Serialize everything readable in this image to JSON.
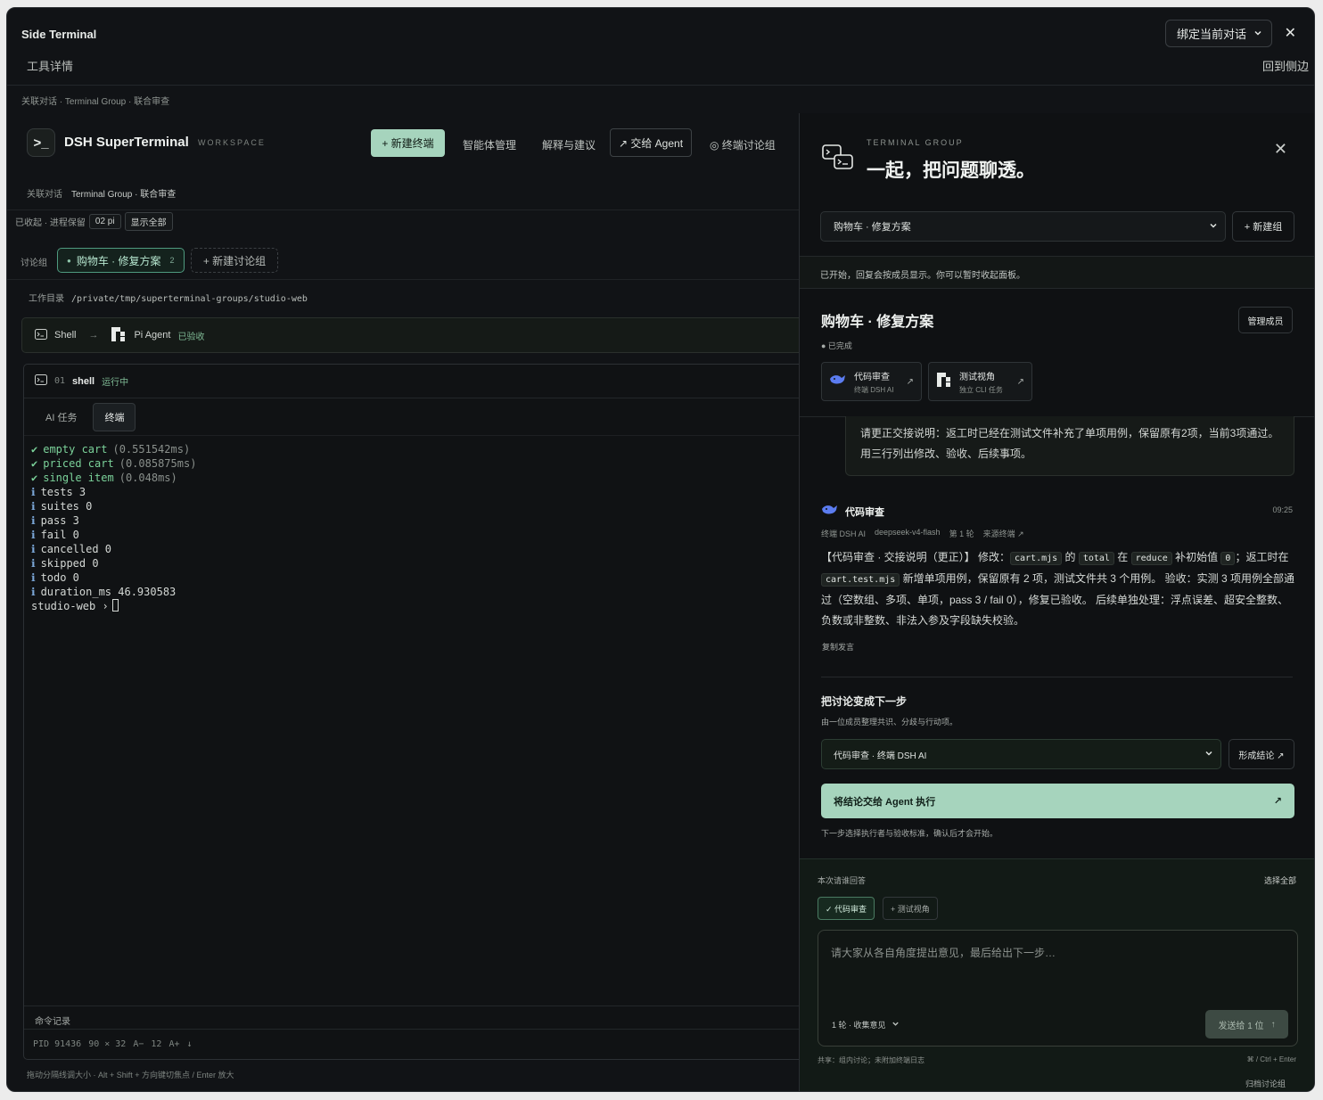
{
  "window": {
    "title": "Side Terminal",
    "subtitle": "工具详情",
    "bind_select": "绑定当前对话",
    "back_to_side": "回到侧边",
    "breadcrumb": "关联对话 · Terminal Group · 联合审查"
  },
  "app": {
    "logo": ">_",
    "name": "DSH SuperTerminal",
    "workspace": "WORKSPACE",
    "new_terminal": "+ 新建终端",
    "nav": [
      "智能体管理",
      "解释与建议"
    ],
    "handoff_agent": "↗ 交给 Agent",
    "terminal_discussion": "◎ 终端讨论组",
    "crumb_label": "关联对话",
    "crumb_value": "Terminal Group · 联合审查",
    "collapsed_label": "已收起 · 进程保留",
    "collapsed_chip": "02 pi",
    "show_all": "显示全部",
    "group_label": "讨论组",
    "group_tab": "购物车 · 修复方案",
    "group_count": "2",
    "new_group": "+ 新建讨论组",
    "workdir_label": "工作目录",
    "workdir_path": "/private/tmp/superterminal-groups/studio-web"
  },
  "flow": {
    "from": "Shell",
    "to": "Pi Agent",
    "status": "已验收"
  },
  "terminal": {
    "index": "01",
    "name": "shell",
    "status": "运行中",
    "tabs": [
      "AI 任务",
      "终端"
    ],
    "lines": [
      {
        "mark": "✔",
        "text": "empty cart",
        "time": "(0.551542ms)"
      },
      {
        "mark": "✔",
        "text": "priced cart",
        "time": "(0.085875ms)"
      },
      {
        "mark": "✔",
        "text": "single item",
        "time": "(0.048ms)"
      },
      {
        "mark": "ℹ",
        "text": "tests 3",
        "time": ""
      },
      {
        "mark": "ℹ",
        "text": "suites 0",
        "time": ""
      },
      {
        "mark": "ℹ",
        "text": "pass 3",
        "time": ""
      },
      {
        "mark": "ℹ",
        "text": "fail 0",
        "time": ""
      },
      {
        "mark": "ℹ",
        "text": "cancelled 0",
        "time": ""
      },
      {
        "mark": "ℹ",
        "text": "skipped 0",
        "time": ""
      },
      {
        "mark": "ℹ",
        "text": "todo 0",
        "time": ""
      },
      {
        "mark": "ℹ",
        "text": "duration_ms 46.930583",
        "time": ""
      }
    ],
    "prompt": "studio-web ›",
    "cmd_log": "命令记录",
    "footer": [
      "PID 91436",
      "90 × 32",
      "A−",
      "12",
      "A+",
      "↓"
    ],
    "resize_hint": "拖动分隔线调大小 · Alt + Shift + 方向键切焦点 / Enter 放大"
  },
  "drawer": {
    "kicker": "TERMINAL GROUP",
    "title": "一起，把问题聊透。",
    "group_select": "购物车 · 修复方案",
    "new_group": "+ 新建组",
    "band": "已开始，回复会按成员显示。你可以暂时收起面板。",
    "group_title": "购物车 · 修复方案",
    "group_status": "● 已完成",
    "manage_members": "管理成员",
    "members": [
      {
        "name": "代码审查",
        "sub": "终端 DSH AI",
        "icon": "whale-icon"
      },
      {
        "name": "测试视角",
        "sub": "独立 CLI 任务",
        "icon": "pi-icon"
      }
    ],
    "quote": "请更正交接说明：返工时已经在测试文件补充了单项用例，保留原有2项，当前3项通过。用三行列出修改、验收、后续事项。",
    "message": {
      "author": "代码审查",
      "time": "09:25",
      "meta": [
        "终端 DSH AI",
        "deepseek-v4-flash",
        "第 1 轮",
        "来源终端 ↗"
      ],
      "p1": "【代码审查 · 交接说明（更正）】 修改：",
      "c1": "cart.mjs",
      "p2": " 的 ",
      "c2": "total",
      "p3": " 在 ",
      "c3": "reduce",
      "p4": " 补初始值 ",
      "c4": "0",
      "p5": "；返工时在 ",
      "c5": "cart.test.mjs",
      "p6": " 新增单项用例，保留原有 2 项，测试文件共 3 个用例。 验收：实测 3 项用例全部通过（空数组、多项、单项，pass 3 / fail 0），修复已验收。 后续单独处理：浮点误差、超安全整数、负数或非整数、非法入参及字段缺失校验。",
      "copy": "复制发言"
    },
    "next": {
      "title": "把讨论变成下一步",
      "sub": "由一位成员整理共识、分歧与行动项。",
      "select": "代码审查 · 终端 DSH AI",
      "conclude": "形成结论 ↗",
      "handoff": "将结论交给 Agent 执行",
      "handoff_arrow": "↗",
      "note": "下一步选择执行者与验收标准，确认后才会开始。"
    },
    "composer": {
      "who_label": "本次请谁回答",
      "select_all": "选择全部",
      "chip_on": "✓ 代码审查",
      "chip_off": "+ 测试视角",
      "placeholder": "请大家从各自角度提出意见，最后给出下一步…",
      "round": "1 轮 · 收集意见",
      "send": "发送给 1 位",
      "share": "共享：组内讨论；未附加终端日志",
      "kbd": "⌘ / Ctrl + Enter",
      "archive": "归档讨论组"
    }
  }
}
